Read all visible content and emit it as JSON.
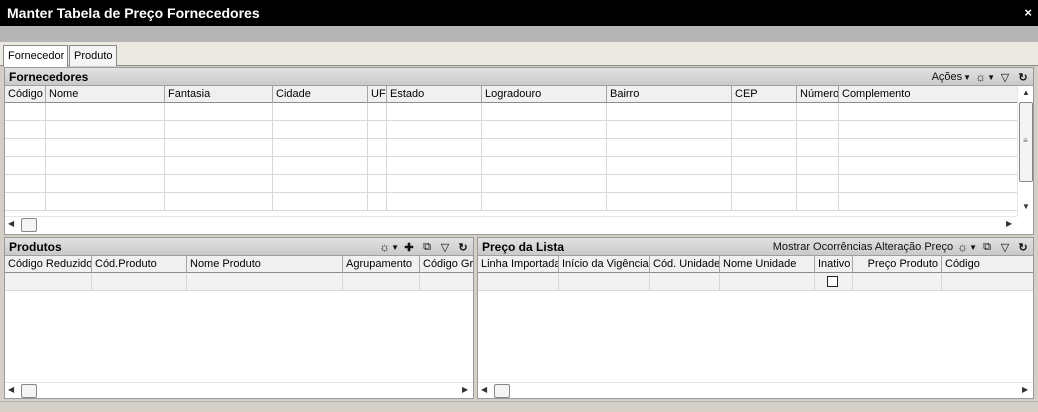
{
  "window": {
    "title": "Manter Tabela de Preço Fornecedores",
    "close": "×"
  },
  "tabs": [
    {
      "label": "Fornecedor"
    },
    {
      "label": "Produto"
    }
  ],
  "fornecedores": {
    "title": "Fornecedores",
    "acoes": "Ações",
    "columns": [
      "Código",
      "Nome",
      "Fantasia",
      "Cidade",
      "UF",
      "Estado",
      "Logradouro",
      "Bairro",
      "CEP",
      "Número",
      "Complemento"
    ]
  },
  "produtos": {
    "title": "Produtos",
    "columns": [
      "Código Reduzido",
      "Cód.Produto",
      "Nome Produto",
      "Agrupamento",
      "Código Gru"
    ]
  },
  "preco": {
    "title": "Preço da Lista",
    "mostrar": "Mostrar Ocorrências Alteração Preço",
    "columns": [
      "Linha Importada",
      "Início da Vigência",
      "Cód. Unidade",
      "Nome Unidade",
      "Inativo",
      "Preço Produto",
      "Código"
    ]
  },
  "icons": {
    "sun": "sun-filter-icon",
    "down": "caret-down-icon",
    "filter": "filter-icon",
    "refresh": "refresh-icon",
    "add": "plus-icon",
    "export": "export-icon"
  }
}
